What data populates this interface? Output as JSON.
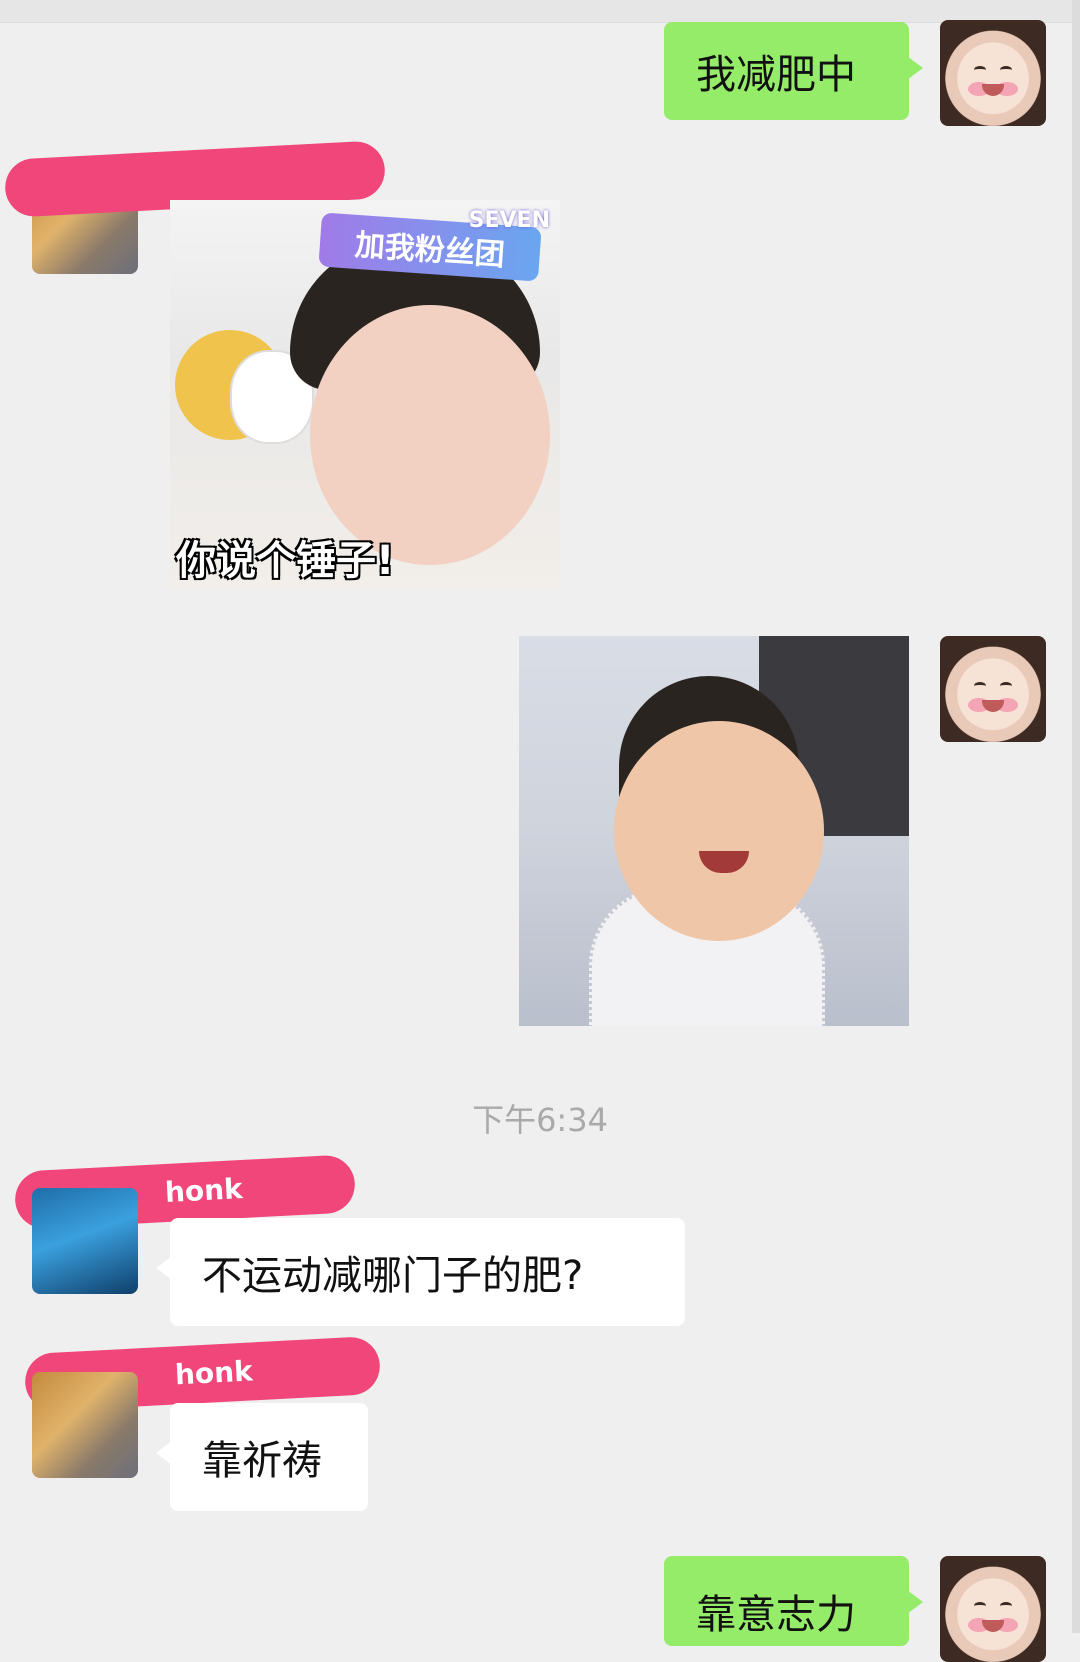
{
  "messages": [
    {
      "id": 1,
      "direction": "outgoing",
      "type": "text",
      "text": "我减肥中"
    },
    {
      "id": 2,
      "direction": "incoming",
      "type": "sticker",
      "sticker": {
        "banner": "加我粉丝团",
        "brand": "SEVEN",
        "caption": "你说个锤子!"
      }
    },
    {
      "id": 3,
      "direction": "outgoing",
      "type": "image"
    },
    {
      "id": 4,
      "direction": "incoming",
      "type": "text",
      "text": "不运动减哪门子的肥?"
    },
    {
      "id": 5,
      "direction": "incoming",
      "type": "text",
      "text": "靠祈祷"
    },
    {
      "id": 6,
      "direction": "outgoing",
      "type": "text",
      "text": "靠意志力"
    }
  ],
  "timestamp": "下午6:34",
  "redacted_names": [
    "honk",
    "honk"
  ],
  "colors": {
    "outgoing_bubble": "#95ec69",
    "incoming_bubble": "#ffffff",
    "background": "#efefef",
    "timestamp_text": "#a9a9a9",
    "redaction": "#f0467a"
  }
}
